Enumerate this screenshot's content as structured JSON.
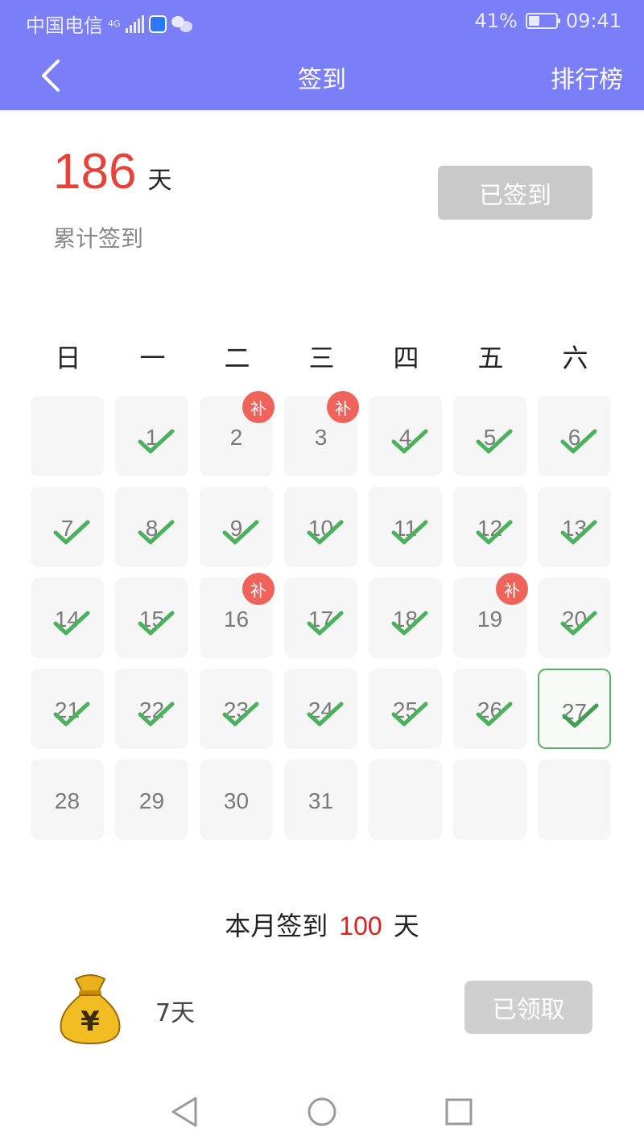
{
  "status": {
    "carrier": "中国电信",
    "network": "4G",
    "battery": "41%",
    "time": "09:41",
    "battery_level": 0.41
  },
  "header": {
    "title": "签到",
    "ranking_label": "排行榜"
  },
  "summary": {
    "total_days": "186",
    "unit": "天",
    "label": "累计签到",
    "signed_button": "已签到"
  },
  "weekdays": [
    "日",
    "一",
    "二",
    "三",
    "四",
    "五",
    "六"
  ],
  "calendar": {
    "makeup_label": "补",
    "days": [
      {
        "n": "",
        "s": "empty"
      },
      {
        "n": "1",
        "s": "signed"
      },
      {
        "n": "2",
        "s": "makeup"
      },
      {
        "n": "3",
        "s": "makeup"
      },
      {
        "n": "4",
        "s": "signed"
      },
      {
        "n": "5",
        "s": "signed"
      },
      {
        "n": "6",
        "s": "signed"
      },
      {
        "n": "7",
        "s": "signed"
      },
      {
        "n": "8",
        "s": "signed"
      },
      {
        "n": "9",
        "s": "signed"
      },
      {
        "n": "10",
        "s": "signed"
      },
      {
        "n": "11",
        "s": "signed"
      },
      {
        "n": "12",
        "s": "signed"
      },
      {
        "n": "13",
        "s": "signed"
      },
      {
        "n": "14",
        "s": "signed"
      },
      {
        "n": "15",
        "s": "signed"
      },
      {
        "n": "16",
        "s": "makeup"
      },
      {
        "n": "17",
        "s": "signed"
      },
      {
        "n": "18",
        "s": "signed"
      },
      {
        "n": "19",
        "s": "makeup"
      },
      {
        "n": "20",
        "s": "signed"
      },
      {
        "n": "21",
        "s": "signed"
      },
      {
        "n": "22",
        "s": "signed"
      },
      {
        "n": "23",
        "s": "signed"
      },
      {
        "n": "24",
        "s": "signed"
      },
      {
        "n": "25",
        "s": "signed"
      },
      {
        "n": "26",
        "s": "signed"
      },
      {
        "n": "27",
        "s": "today"
      },
      {
        "n": "28",
        "s": "future"
      },
      {
        "n": "29",
        "s": "future"
      },
      {
        "n": "30",
        "s": "future"
      },
      {
        "n": "31",
        "s": "future"
      },
      {
        "n": "",
        "s": "empty"
      },
      {
        "n": "",
        "s": "empty"
      },
      {
        "n": "",
        "s": "empty"
      }
    ]
  },
  "month": {
    "prefix": "本月签到",
    "count": "100",
    "suffix": "天"
  },
  "reward": {
    "icon": "money-bag-icon",
    "days": "7天",
    "button": "已领取"
  },
  "colors": {
    "header": "#7b7ff7",
    "accent_red": "#e74238",
    "check_green": "#4cb15c",
    "badge": "#f0635a"
  }
}
